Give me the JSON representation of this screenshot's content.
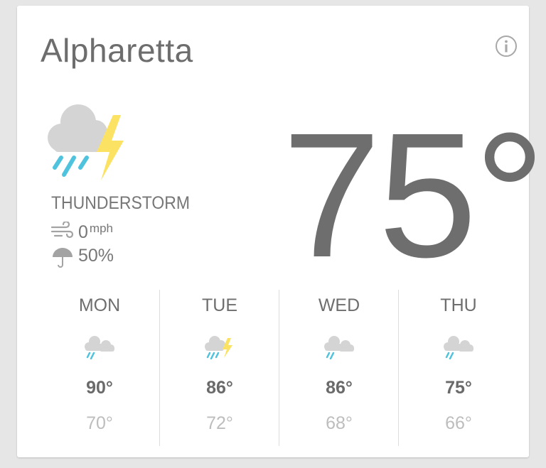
{
  "location": {
    "city": "Alpharetta"
  },
  "current": {
    "temperature": "75°",
    "condition": "THUNDERSTORM",
    "condition_icon": "thunderstorm-icon",
    "wind": {
      "value": "0",
      "unit": "mph"
    },
    "precipitation": "50%"
  },
  "forecast": [
    {
      "day": "MON",
      "icon": "rain-icon",
      "high": "90°",
      "low": "70°"
    },
    {
      "day": "TUE",
      "icon": "thunderstorm-icon",
      "high": "86°",
      "low": "72°"
    },
    {
      "day": "WED",
      "icon": "rain-icon",
      "high": "86°",
      "low": "68°"
    },
    {
      "day": "THU",
      "icon": "rain-icon",
      "high": "75°",
      "low": "66°"
    }
  ],
  "colors": {
    "cloud": "#d4d4d4",
    "rain": "#4fc3dd",
    "lightning": "#fbe262",
    "text": "#6e6e6e",
    "low_temp": "#bdbdbd"
  }
}
